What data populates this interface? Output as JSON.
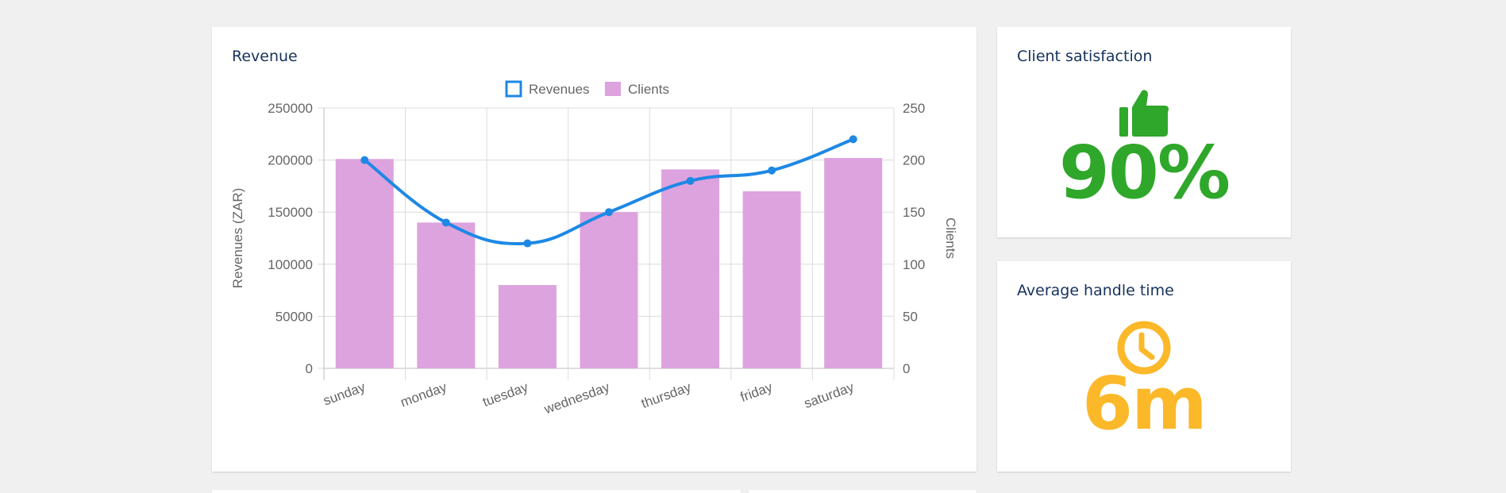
{
  "colors": {
    "revenue_line": "#1e88e5",
    "clients_bar": "#dda3de",
    "satisfaction": "#2fa72a",
    "handle_time": "#fbb829",
    "title_text": "#16325c",
    "axis_text": "#666666"
  },
  "revenue_card": {
    "title": "Revenue"
  },
  "chart_data": {
    "type": "bar",
    "categories": [
      "sunday",
      "monday",
      "tuesday",
      "wednesday",
      "thursday",
      "friday",
      "saturday"
    ],
    "series": [
      {
        "name": "Revenues",
        "type": "line",
        "axis": "left",
        "values": [
          200000,
          140000,
          120000,
          150000,
          180000,
          190000,
          220000
        ]
      },
      {
        "name": "Clients",
        "type": "bar",
        "axis": "right",
        "values": [
          201,
          140,
          80,
          150,
          191,
          170,
          202
        ]
      }
    ],
    "ylabel": "Revenues (ZAR)",
    "y2label": "Clients",
    "ylim": [
      0,
      250000
    ],
    "y2lim": [
      0,
      250
    ],
    "y_ticks": [
      "0",
      "50000",
      "100000",
      "150000",
      "200000",
      "250000"
    ],
    "y2_ticks": [
      "0",
      "50",
      "100",
      "150",
      "200",
      "250"
    ],
    "legend": "top",
    "grid": true
  },
  "satisfaction_card": {
    "title": "Client satisfaction",
    "value": "90%",
    "icon": "thumbs-up-icon"
  },
  "aht_card": {
    "title": "Average handle time",
    "value": "6m",
    "icon": "clock-icon"
  }
}
